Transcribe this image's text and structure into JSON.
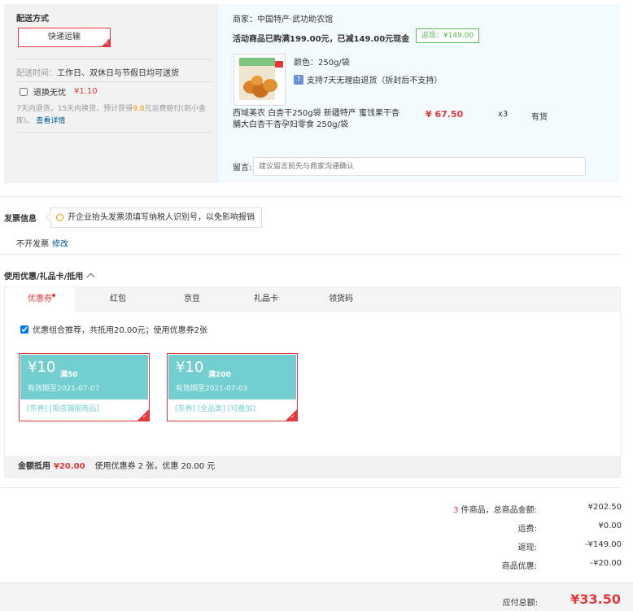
{
  "shipping": {
    "title": "配送方式",
    "method": "快递运输",
    "time_label": "配送时间：",
    "time_value": "工作日、双休日与节假日均可送货",
    "return_label": "退换无忧",
    "return_price": "¥1.10",
    "return_desc_1": "7天内退货，15天内换货，预计获得",
    "return_desc_highlight": "9.8",
    "return_desc_2": "元运费赔付(到小金库)。",
    "return_desc_link": "查看详情"
  },
  "shop": {
    "merchant": "商家：中国特产·武功助农馆",
    "promo": "活动商品已购满199.00元，已减149.00元现金",
    "rebate": "返现：¥149.00"
  },
  "product": {
    "attr": "颜色：250g/袋",
    "support_badge": "7",
    "support": "支持7天无理由退货（拆封后不支持）",
    "name": "西域美农 白杏干250g袋 新疆特产 蜜饯果干杏脯大白杏干杏孕妇零食 250g/袋",
    "price": "¥ 67.50",
    "qty": "x3",
    "stock": "有货"
  },
  "remark": {
    "label": "留言:",
    "placeholder": "建议留言前先与商家沟通确认"
  },
  "invoice": {
    "title": "发票信息",
    "tip": "开企业抬头发票须填写纳税人识别号，以免影响报销",
    "value": "不开发票",
    "edit": "修改"
  },
  "coupons": {
    "title": "使用优惠/礼品卡/抵用",
    "tabs": [
      "优惠券",
      "红包",
      "京豆",
      "礼品卡",
      "领货码"
    ],
    "combo": "优惠组合推荐，共抵用20.00元；使用优惠券2张",
    "items": [
      {
        "amount": "¥10",
        "cond": "满50",
        "expiry": "有效期至2021-07-07",
        "tag1": "[东券]",
        "tag2": "[限店铺限商品]",
        "tag3": ""
      },
      {
        "amount": "¥10",
        "cond": "满200",
        "expiry": "有效期至2021-07-03",
        "tag1": "[东券]",
        "tag2": "[全品类]",
        "tag3": "[可叠加]"
      }
    ],
    "footer_label": "金额抵用",
    "footer_amount": "¥20.00",
    "footer_desc": "使用优惠券 2 张，优惠 20.00 元"
  },
  "summary": {
    "count": "3",
    "count_label": " 件商品，总商品金额:",
    "goods_total": "¥202.50",
    "shipping_label": "运费:",
    "shipping": "¥0.00",
    "rebate_label": "返现:",
    "rebate": "-¥149.00",
    "discount_label": "商品优惠:",
    "discount": "-¥20.00",
    "total_label": "应付总额:",
    "total": "¥33.50"
  },
  "colors": {
    "accent": "#e4393c",
    "coupon": "#73cfcf",
    "link": "#005aa0"
  }
}
